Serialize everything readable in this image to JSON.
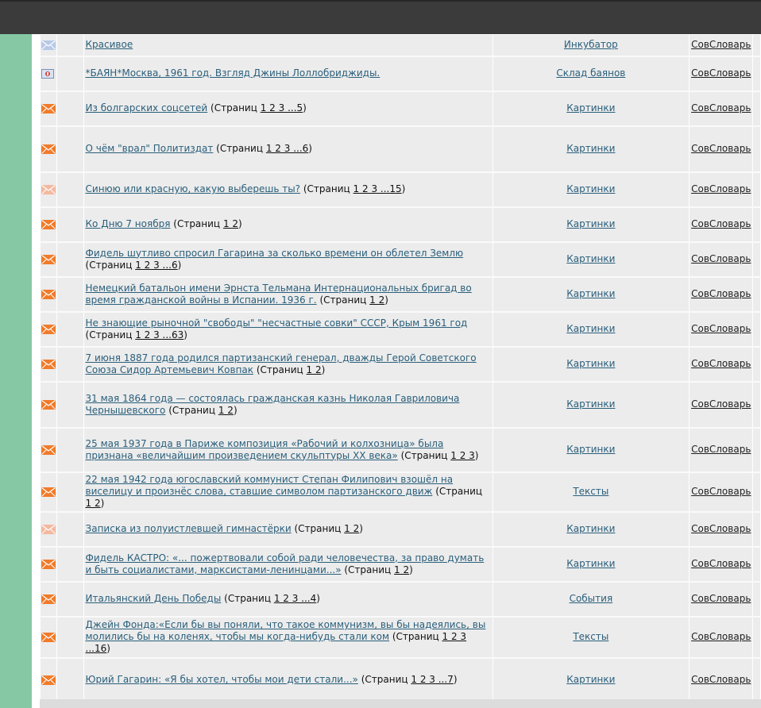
{
  "rows": [
    {
      "topic": "Красивое",
      "pages_prefix": "",
      "pages": "",
      "forum": "Инкубатор",
      "section": "СовСловарь",
      "icon": "envelope-pale-blue-icon",
      "h": 27
    },
    {
      "topic": "*БАЯН*Москва, 1961 год. Взгляд Джины Лоллобриджиды.",
      "pages_prefix": "",
      "pages": "",
      "forum": "Склад баянов",
      "section": "СовСловарь",
      "icon": "poll-icon",
      "h": 44
    },
    {
      "topic": "Из болгарских соцсетей",
      "pages_prefix": "(Страниц",
      "pages": "1 2 3 ...5",
      "pages_suffix": ")",
      "forum": "Картинки",
      "section": "СовСловарь",
      "icon": "envelope-orange-icon",
      "h": 44
    },
    {
      "topic": "О чём \"врал\" Политиздат",
      "pages_prefix": "(Страниц",
      "pages": "1 2 3 ...6",
      "pages_suffix": ")",
      "forum": "Картинки",
      "section": "СовСловарь",
      "icon": "envelope-orange-icon",
      "h": 58
    },
    {
      "topic": "Синюю или красную, какую выберешь ты?",
      "pages_prefix": "(Страниц",
      "pages": "1 2 3 ...15",
      "pages_suffix": ")",
      "forum": "Картинки",
      "section": "СовСловарь",
      "icon": "envelope-pale-orange-icon",
      "h": 44
    },
    {
      "topic": "Ко Дню 7 ноября",
      "pages_prefix": "(Страниц",
      "pages": "1 2",
      "pages_suffix": ")",
      "forum": "Картинки",
      "section": "СовСловарь",
      "icon": "envelope-orange-icon",
      "h": 44
    },
    {
      "topic": "Фидель шутливо спросил Гагарина за сколько времени он облетел Землю",
      "pages_prefix": "(Страниц",
      "pages": "1 2 3 ...6",
      "pages_suffix": ")",
      "forum": "Картинки",
      "section": "СовСловарь",
      "icon": "envelope-orange-icon",
      "h": 44
    },
    {
      "topic": "Немецкий батальон имени Эрнста Тельмана Интернациональных бригад во время гражданской войны в Испании. 1936 г.",
      "pages_prefix": "(Страниц",
      "pages": "1 2",
      "pages_suffix": ")",
      "forum": "Картинки",
      "section": "СовСловарь",
      "icon": "envelope-orange-icon",
      "h": 44
    },
    {
      "topic": "Не знающие рыночной \"свободы\" \"несчастные совки\" СССР, Крым 1961 год",
      "pages_prefix": "(Страниц",
      "pages": "1 2 3 ...63",
      "pages_suffix": ")",
      "forum": "Картинки",
      "section": "СовСловарь",
      "icon": "envelope-orange-icon",
      "h": 44
    },
    {
      "topic": "7 июня 1887 года родился партизанский генерал, дважды Герой Советского Союза Сидор Артемьевич Ковпак",
      "pages_prefix": "(Страниц",
      "pages": "1 2",
      "pages_suffix": ")",
      "forum": "Картинки",
      "section": "СовСловарь",
      "icon": "envelope-orange-icon",
      "h": 44
    },
    {
      "topic": "31 мая 1864 года — состоялась гражданская казнь Николая Гавриловича Чернышевского",
      "pages_prefix": "(Страниц",
      "pages": "1 2",
      "pages_suffix": ")",
      "forum": "Картинки",
      "section": "СовСловарь",
      "icon": "envelope-orange-icon",
      "h": 58
    },
    {
      "topic": "25 мая 1937 года в Париже композиция «Рабочий и колхозница» была признана «величайшим произведением скульптуры XX века»",
      "pages_prefix": "(Страниц",
      "pages": "1 2 3",
      "pages_suffix": ")",
      "forum": "Картинки",
      "section": "СовСловарь",
      "icon": "envelope-orange-icon",
      "h": 56
    },
    {
      "topic": "22 мая 1942 года югославский коммунист Степан Филипович взошёл на виселицу и произнёс слова, ставшие символом партизанского движ",
      "pages_prefix": "(Страниц",
      "pages": "1 2",
      "pages_suffix": ")",
      "forum": "Тексты",
      "section": "СовСловарь",
      "icon": "envelope-orange-icon",
      "h": 50
    },
    {
      "topic": "Записка из полуистлевшей гимнастёрки",
      "pages_prefix": "(Страниц",
      "pages": "1 2",
      "pages_suffix": ")",
      "forum": "Картинки",
      "section": "СовСловарь",
      "icon": "envelope-pale-orange-icon",
      "h": 44
    },
    {
      "topic": "Фидель КАСТРО: «... пожертвовали собой ради человечества, за право думать и быть социалистами, марксистами-ленинцами...»",
      "pages_prefix": "(Страниц",
      "pages": "1 2",
      "pages_suffix": ")",
      "forum": "Картинки",
      "section": "СовСловарь",
      "icon": "envelope-orange-icon",
      "h": 44
    },
    {
      "topic": "Итальянский День Победы",
      "pages_prefix": "(Страниц",
      "pages": "1 2 3 ...4",
      "pages_suffix": ")",
      "forum": "События",
      "section": "СовСловарь",
      "icon": "envelope-orange-icon",
      "h": 44
    },
    {
      "topic": "Джейн Фонда:«Если бы вы поняли, что такое коммунизм, вы бы надеялись, вы молились бы на коленях, чтобы мы когда-нибудь стали ком",
      "pages_prefix": "(Страниц",
      "pages": "1 2 3 ...16",
      "pages_suffix": ")",
      "forum": "Тексты",
      "section": "СовСловарь",
      "icon": "envelope-orange-icon",
      "h": 52
    },
    {
      "topic": "Юрий Гагарин: «Я бы хотел, чтобы мои дети стали...»",
      "pages_prefix": "(Страниц",
      "pages": "1 2 3 ...7",
      "pages_suffix": ")",
      "forum": "Картинки",
      "section": "СовСловарь",
      "icon": "envelope-orange-icon",
      "h": 56
    }
  ],
  "colors": {
    "orange": "#f07b2a",
    "pale_orange": "#f3b9a0",
    "pale_blue": "#b7c9e6",
    "link": "#2a5f7b"
  }
}
